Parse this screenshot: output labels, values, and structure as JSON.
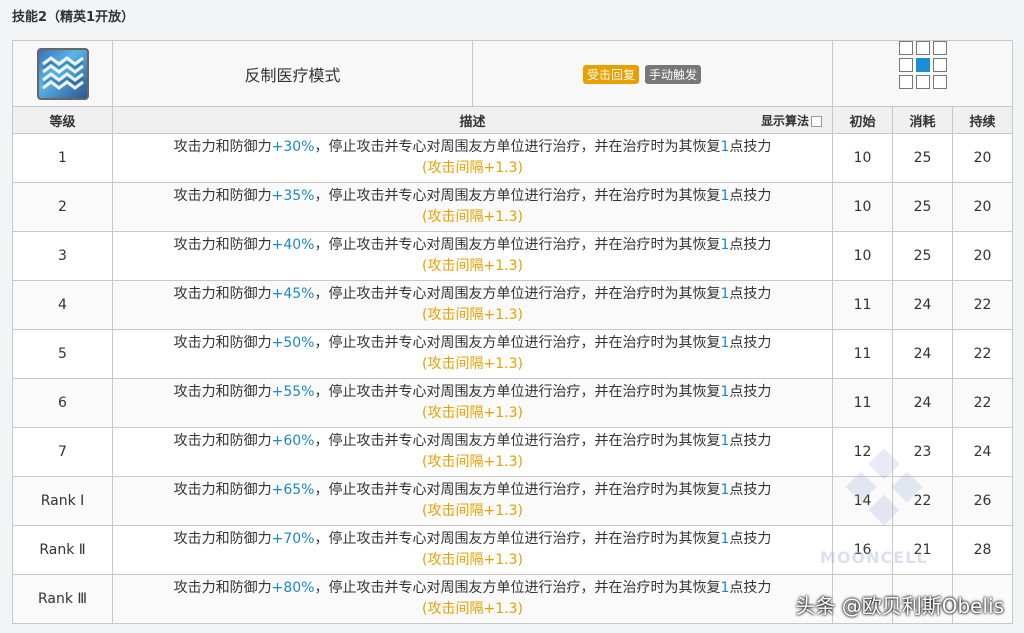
{
  "title": "技能2（精英1开放）",
  "skill": {
    "icon": "skill-icon",
    "name": "反制医疗模式",
    "tags": [
      "受击回复",
      "手动触发"
    ],
    "range_icon": "range-grid-icon"
  },
  "headers": {
    "level": "等级",
    "description": "描述",
    "show_algo": "显示算法",
    "initial": "初始",
    "cost": "消耗",
    "duration": "持续"
  },
  "desc_parts": {
    "pre": "攻击力和防御力",
    "mid": "，停止攻击并专心对周围友方单位进行治疗，并在治疗时为其恢复",
    "sp": "1",
    "post": "点技力",
    "sub": "(攻击间隔+1.3)"
  },
  "rows": [
    {
      "level": "1",
      "bonus": "+30%",
      "initial": "10",
      "cost": "25",
      "duration": "20"
    },
    {
      "level": "2",
      "bonus": "+35%",
      "initial": "10",
      "cost": "25",
      "duration": "20"
    },
    {
      "level": "3",
      "bonus": "+40%",
      "initial": "10",
      "cost": "25",
      "duration": "20"
    },
    {
      "level": "4",
      "bonus": "+45%",
      "initial": "11",
      "cost": "24",
      "duration": "22"
    },
    {
      "level": "5",
      "bonus": "+50%",
      "initial": "11",
      "cost": "24",
      "duration": "22"
    },
    {
      "level": "6",
      "bonus": "+55%",
      "initial": "11",
      "cost": "24",
      "duration": "22"
    },
    {
      "level": "7",
      "bonus": "+60%",
      "initial": "12",
      "cost": "23",
      "duration": "24"
    },
    {
      "level": "Rank Ⅰ",
      "bonus": "+65%",
      "initial": "14",
      "cost": "22",
      "duration": "26"
    },
    {
      "level": "Rank Ⅱ",
      "bonus": "+70%",
      "initial": "16",
      "cost": "21",
      "duration": "28"
    },
    {
      "level": "Rank Ⅲ",
      "bonus": "+80%",
      "initial": "",
      "cost": "",
      "duration": ""
    }
  ],
  "watermark_text": "MOONCELL",
  "attribution": "头条 @欧贝利斯Obelis",
  "colors": {
    "highlight": "#1d88c9",
    "interval": "#e8a000",
    "tag_auto": "#e8a000",
    "tag_manual": "#777777",
    "range_self": "#1c8ed8"
  }
}
